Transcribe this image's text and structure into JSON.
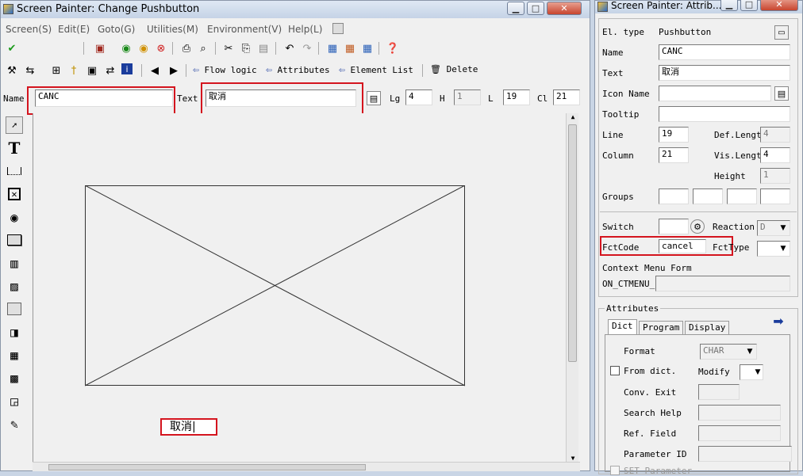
{
  "main_window": {
    "title": "Screen Painter:  Change Pushbutton",
    "menu": [
      "Screen(S)",
      "Edit(E)",
      "Goto(G)",
      "Utilities(M)",
      "Environment(V)",
      "Help(L)"
    ],
    "toolbar2": {
      "flow_logic": "Flow logic",
      "attributes": "Attributes",
      "element_list": "Element List",
      "delete": "Delete"
    },
    "element_bar": {
      "name_label": "Name",
      "name_value": "CANC",
      "text_label": "Text",
      "text_value": "取消",
      "lg_label": "Lg",
      "lg_value": "4",
      "h_label": "H",
      "h_value": "1",
      "l_label": "L",
      "l_value": "19",
      "cl_label": "Cl",
      "cl_value": "21"
    },
    "pushbutton_text": "取消"
  },
  "attr_window": {
    "title": "Screen Painter: Attrib...",
    "el_type_label": "El. type",
    "el_type_value": "Pushbutton",
    "name_label": "Name",
    "name_value": "CANC",
    "text_label": "Text",
    "text_value": "取消",
    "icon_name_label": "Icon Name",
    "icon_name_value": "",
    "tooltip_label": "Tooltip",
    "tooltip_value": "",
    "line_label": "Line",
    "line_value": "19",
    "column_label": "Column",
    "column_value": "21",
    "def_length_label": "Def.Length",
    "def_length_value": "4",
    "vis_length_label": "Vis.Length",
    "vis_length_value": "4",
    "height_label": "Height",
    "height_value": "1",
    "groups_label": "Groups",
    "switch_label": "Switch",
    "reaction_label": "Reaction",
    "reaction_value": "D",
    "fctcode_label": "FctCode",
    "fctcode_value": "cancel",
    "fcttype_label": "FctType",
    "fcttype_value": "",
    "context_menu_label": "Context Menu Form",
    "on_ctmenu_label": "ON_CTMENU_",
    "on_ctmenu_value": "",
    "attributes_group": "Attributes",
    "tabs": [
      "Dict",
      "Program",
      "Display"
    ],
    "format_label": "Format",
    "format_value": "CHAR",
    "from_dict_label": "From dict.",
    "modify_label": "Modify",
    "conv_exit_label": "Conv. Exit",
    "search_help_label": "Search Help",
    "ref_field_label": "Ref. Field",
    "parameter_id_label": "Parameter ID",
    "set_parameter_label": "SET Parameter"
  },
  "colors": {
    "highlight": "#d4141e",
    "titlebar": "#c5d3e6"
  }
}
